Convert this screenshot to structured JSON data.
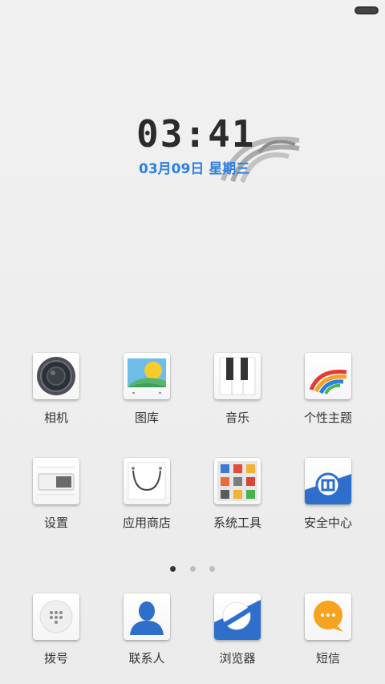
{
  "clock": {
    "time": "03:41",
    "date": "03月09日 星期三"
  },
  "apps_row1": [
    {
      "label": "相机",
      "icon": "camera-icon"
    },
    {
      "label": "图库",
      "icon": "gallery-icon"
    },
    {
      "label": "音乐",
      "icon": "piano-icon"
    },
    {
      "label": "个性主题",
      "icon": "theme-icon"
    }
  ],
  "apps_row2": [
    {
      "label": "设置",
      "icon": "toggle-icon"
    },
    {
      "label": "应用商店",
      "icon": "shopping-bag-icon"
    },
    {
      "label": "系统工具",
      "icon": "tools-grid-icon"
    },
    {
      "label": "安全中心",
      "icon": "shield-icon"
    }
  ],
  "page_indicator": {
    "count": 3,
    "active": 1
  },
  "dock": [
    {
      "label": "拨号",
      "icon": "dialpad-icon"
    },
    {
      "label": "联系人",
      "icon": "contact-person-icon"
    },
    {
      "label": "浏览器",
      "icon": "browser-globe-icon"
    },
    {
      "label": "短信",
      "icon": "message-bubble-icon"
    }
  ],
  "colors": {
    "date_blue": "#2f7fe0",
    "accent_blue": "#2e6fcb",
    "sms_orange": "#f6a320"
  }
}
